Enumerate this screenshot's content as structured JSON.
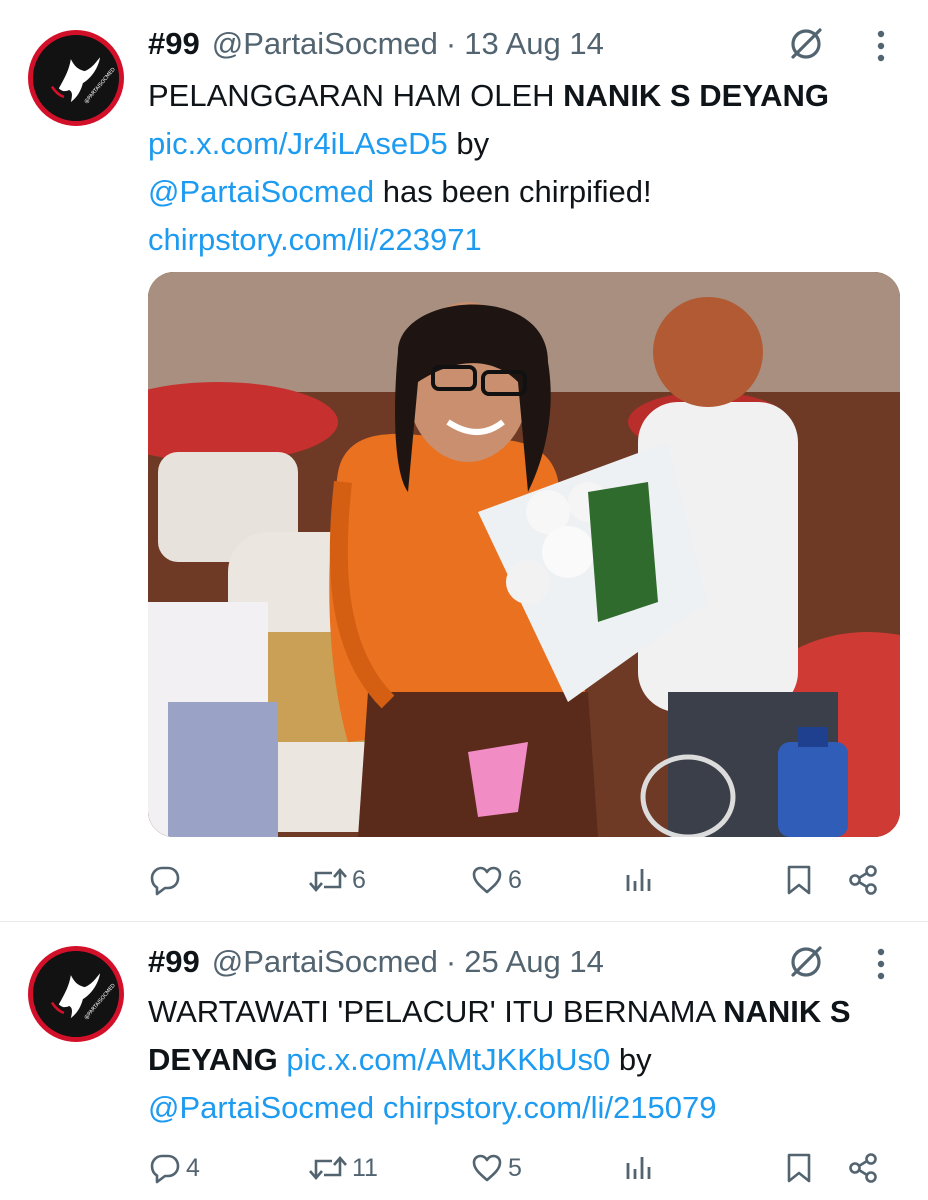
{
  "tweets": [
    {
      "name": "#99",
      "handle": "@PartaiSocmed",
      "separator": "·",
      "date": "13 Aug 14",
      "text_parts": {
        "p1": "PELANGGARAN HAM OLEH ",
        "bold": "NANIK S DEYANG",
        "link1": "pic.x.com/Jr4iLAseD5",
        "p2": " by ",
        "mention": "@PartaiSocmed",
        "p3": " has been chirpified!",
        "link2": "chirpstory.com/li/223971"
      },
      "avatar_text": "@PARTAISOCMED",
      "has_media": true,
      "stats": {
        "replies": "",
        "reposts": "6",
        "likes": "6"
      }
    },
    {
      "name": "#99",
      "handle": "@PartaiSocmed",
      "separator": "·",
      "date": "25 Aug 14",
      "text_parts": {
        "p1": "WARTAWATI 'PELACUR' ITU BERNAMA ",
        "bold": "NANIK S DEYANG",
        "link1": "pic.x.com/AMtJKKbUs0",
        "p2": " by ",
        "mention": "@PartaiSocmed",
        "p3": " ",
        "link2": "chirpstory.com/li/215079"
      },
      "avatar_text": "@PARTAISOCMED",
      "has_media": false,
      "stats": {
        "replies": "4",
        "reposts": "11",
        "likes": "5"
      }
    }
  ],
  "icons": {
    "reply": "reply-icon",
    "repost": "repost-icon",
    "like": "heart-icon",
    "views": "analytics-icon",
    "bookmark": "bookmark-icon",
    "share": "share-icon",
    "grok": "grok-icon",
    "more": "more-vertical-icon"
  },
  "colors": {
    "link": "#1d9bf0",
    "muted": "#536471",
    "text": "#0f1419",
    "avatar_ring": "#d3102a"
  }
}
